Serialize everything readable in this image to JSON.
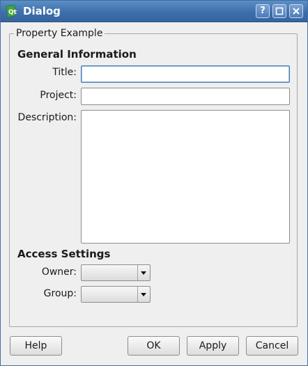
{
  "window": {
    "title": "Dialog",
    "help_button": "?",
    "app_icon": "qt-icon",
    "maximize_icon": "maximize-icon",
    "close_icon": "close-icon"
  },
  "group": {
    "title": "Property Example"
  },
  "general": {
    "heading": "General Information",
    "title_label": "Title:",
    "title_value": "",
    "project_label": "Project:",
    "project_value": "",
    "description_label": "Description:",
    "description_value": ""
  },
  "access": {
    "heading": "Access Settings",
    "owner_label": "Owner:",
    "owner_value": "",
    "group_label": "Group:",
    "group_value": ""
  },
  "buttons": {
    "help": "Help",
    "ok": "OK",
    "apply": "Apply",
    "cancel": "Cancel"
  },
  "colors": {
    "titlebar": "#3d6fac",
    "window_bg": "#efefef",
    "focus_border": "#4a7db8"
  }
}
